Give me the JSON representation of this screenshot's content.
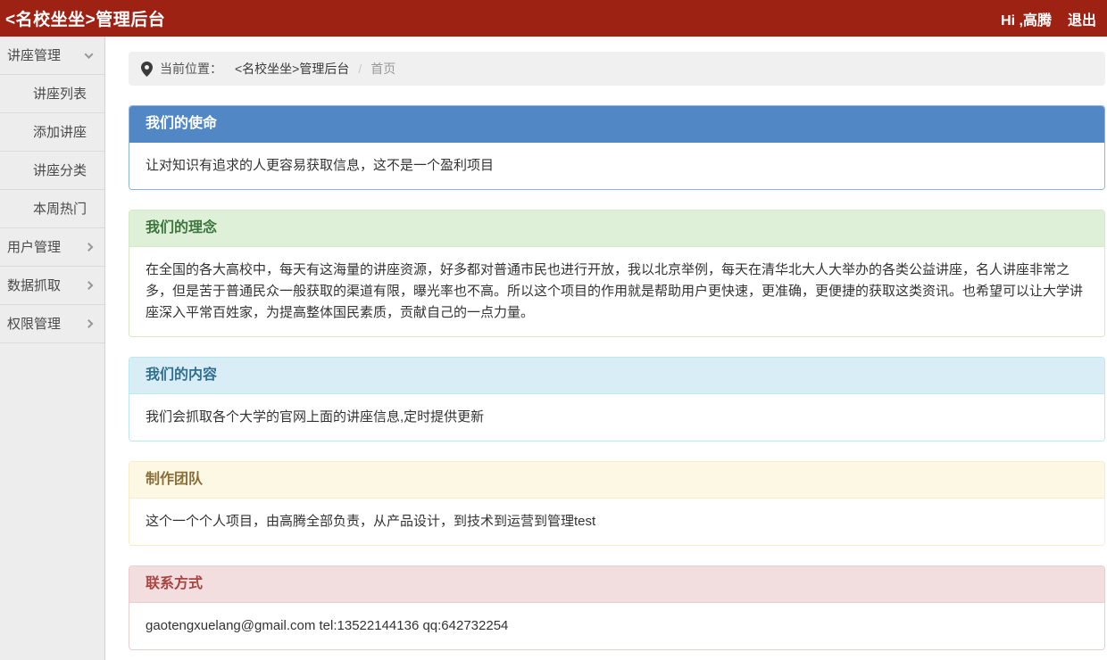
{
  "topbar": {
    "title": "<名校坐坐>管理后台",
    "greeting": "Hi ,高腾",
    "logout": "退出"
  },
  "sidebar": {
    "items": [
      {
        "label": "讲座管理",
        "chevron": "down",
        "children": [
          "讲座列表",
          "添加讲座",
          "讲座分类",
          "本周热门"
        ]
      },
      {
        "label": "用户管理",
        "chevron": "right"
      },
      {
        "label": "数据抓取",
        "chevron": "right"
      },
      {
        "label": "权限管理",
        "chevron": "right"
      }
    ]
  },
  "breadcrumb": {
    "icon": "location-pin-icon",
    "label": "当前位置：",
    "root": "<名校坐坐>管理后台",
    "separator": "/",
    "current": "首页"
  },
  "panels": [
    {
      "variant": "primary",
      "title": "我们的使命",
      "body": "让对知识有追求的人更容易获取信息，这不是一个盈利项目"
    },
    {
      "variant": "success",
      "title": "我们的理念",
      "body": "在全国的各大高校中，每天有这海量的讲座资源，好多都对普通市民也进行开放，我以北京举例，每天在清华北大人大举办的各类公益讲座，名人讲座非常之多，但是苦于普通民众一般获取的渠道有限，曝光率也不高。所以这个项目的作用就是帮助用户更快速，更准确，更便捷的获取这类资讯。也希望可以让大学讲座深入平常百姓家，为提高整体国民素质，贡献自己的一点力量。"
    },
    {
      "variant": "info",
      "title": "我们的内容",
      "body": "我们会抓取各个大学的官网上面的讲座信息,定时提供更新"
    },
    {
      "variant": "warning",
      "title": "制作团队",
      "body": "这个一个个人项目，由高腾全部负责，从产品设计，到技术到运营到管理test"
    },
    {
      "variant": "danger",
      "title": "联系方式",
      "body": "gaotengxuelang@gmail.com tel:13522144136 qq:642732254"
    }
  ],
  "colors": {
    "topbar_bg": "#9E2214",
    "sidebar_bg": "#EDEDED",
    "primary_header_bg": "#5287C5",
    "success_header_bg": "#DFF0D8",
    "info_header_bg": "#D9EDF7",
    "warning_header_bg": "#FCF8E3",
    "danger_header_bg": "#F2DEDE"
  }
}
